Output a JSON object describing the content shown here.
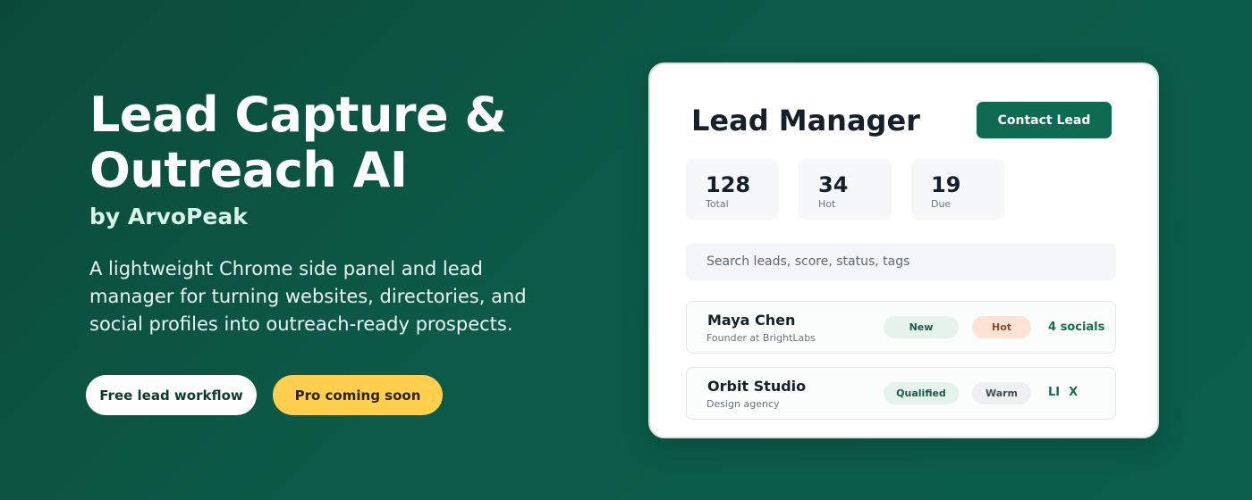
{
  "hero": {
    "title": "Lead Capture & Outreach AI",
    "subtitle": "by ArvoPeak",
    "description": "A lightweight Chrome side panel and lead manager for turning websites, directories, and social profiles into outreach-ready prospects.",
    "cta_free": "Free lead workflow",
    "cta_pro": "Pro coming soon"
  },
  "card": {
    "title": "Lead Manager",
    "contact_button": "Contact Lead",
    "stats": [
      {
        "value": "128",
        "label": "Total"
      },
      {
        "value": "34",
        "label": "Hot"
      },
      {
        "value": "19",
        "label": "Due"
      }
    ],
    "search_placeholder": "Search leads, score, status, tags",
    "leads": [
      {
        "name": "Maya Chen",
        "role": "Founder at BrightLabs",
        "status": "New",
        "temperature": "Hot",
        "socials": "4 socials"
      },
      {
        "name": "Orbit Studio",
        "role": "Design agency",
        "status": "Qualified",
        "temperature": "Warm",
        "social_li": "LI",
        "social_x": "X"
      }
    ]
  },
  "colors": {
    "background": "#0b4a3a",
    "accent": "#0e6b52",
    "pro_button": "#ffcf4d",
    "hot_tag": "#fde3d4",
    "new_tag": "#e5f3ec"
  },
  "icons": [
    "linkedin-icon",
    "x-icon"
  ]
}
